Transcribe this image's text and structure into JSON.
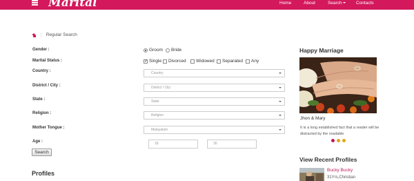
{
  "header": {
    "brand": "Marital",
    "nav": [
      "Home",
      "About",
      "Search",
      "Contacts"
    ],
    "accent": "#d3185b"
  },
  "breadcrumb": {
    "current": "Regular Search"
  },
  "form": {
    "gender": {
      "label": "Gender :",
      "options": [
        "Groom",
        "Bride"
      ],
      "selected": "Groom"
    },
    "marital": {
      "label": "Marital Status :",
      "options": [
        "Single",
        "Divorced",
        "Widowed",
        "Separated",
        "Any"
      ],
      "checked": [
        "Single"
      ]
    },
    "country": {
      "label": "Country :",
      "placeholder": "Country"
    },
    "district": {
      "label": "District / City :",
      "placeholder": "District / City"
    },
    "state": {
      "label": "State :",
      "placeholder": "State"
    },
    "religion": {
      "label": "Religion :",
      "placeholder": "Religion"
    },
    "tongue": {
      "label": "Mother Tongue :",
      "value": "Malayalam"
    },
    "age": {
      "label": "Age :",
      "from": "18",
      "to": "30"
    },
    "search_button": "Search"
  },
  "profiles_heading": "Profiles",
  "sidebar": {
    "happy_heading": "Happy Marriage",
    "story_name": "Jhon & Mary",
    "story_text": "It is a long established fact that a reader will be distracted by the readable",
    "carousel_dot_colors": [
      "#c0185a",
      "#e8a317",
      "#e8a317"
    ],
    "recent_heading": "View Recent Profiles",
    "recent_name": "Bucky Bucky",
    "recent_meta": "31Yrs,Christian"
  }
}
